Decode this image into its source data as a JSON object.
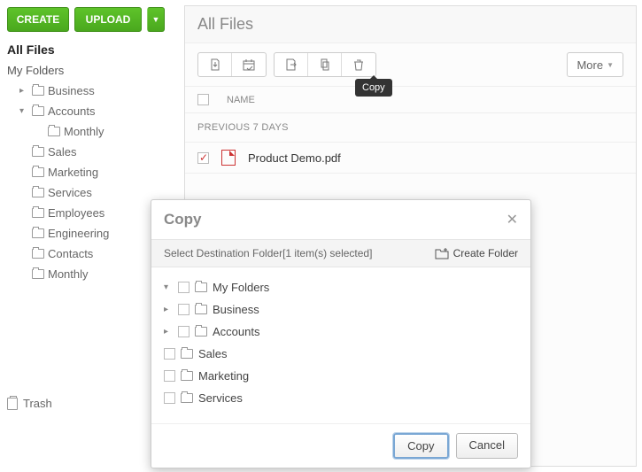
{
  "sidebar": {
    "create_label": "CREATE",
    "upload_label": "UPLOAD",
    "all_files": "All Files",
    "my_folders": "My Folders",
    "items": [
      {
        "label": "Business",
        "expand": "▸",
        "indent": 1
      },
      {
        "label": "Accounts",
        "expand": "▾",
        "indent": 1
      },
      {
        "label": "Monthly",
        "expand": "",
        "indent": 2
      },
      {
        "label": "Sales",
        "expand": "",
        "indent": 1
      },
      {
        "label": "Marketing",
        "expand": "",
        "indent": 1
      },
      {
        "label": "Services",
        "expand": "",
        "indent": 1
      },
      {
        "label": "Employees",
        "expand": "",
        "indent": 1
      },
      {
        "label": "Engineering",
        "expand": "",
        "indent": 1
      },
      {
        "label": "Contacts",
        "expand": "",
        "indent": 1
      },
      {
        "label": "Monthly",
        "expand": "",
        "indent": 1
      }
    ],
    "trash": "Trash"
  },
  "main": {
    "title": "All Files",
    "more": "More",
    "tooltip": "Copy",
    "col_name": "NAME",
    "section": "PREVIOUS 7 DAYS",
    "file": "Product Demo.pdf"
  },
  "modal": {
    "title": "Copy",
    "subtitle": "Select Destination Folder[1 item(s) selected]",
    "create_folder": "Create Folder",
    "tree": [
      {
        "label": "My Folders",
        "expand": "▾",
        "indent": 1
      },
      {
        "label": "Business",
        "expand": "▸",
        "indent": 2
      },
      {
        "label": "Accounts",
        "expand": "▸",
        "indent": 2
      },
      {
        "label": "Sales",
        "expand": "",
        "indent": 3
      },
      {
        "label": "Marketing",
        "expand": "",
        "indent": 3
      },
      {
        "label": "Services",
        "expand": "",
        "indent": 3
      }
    ],
    "ok": "Copy",
    "cancel": "Cancel"
  }
}
